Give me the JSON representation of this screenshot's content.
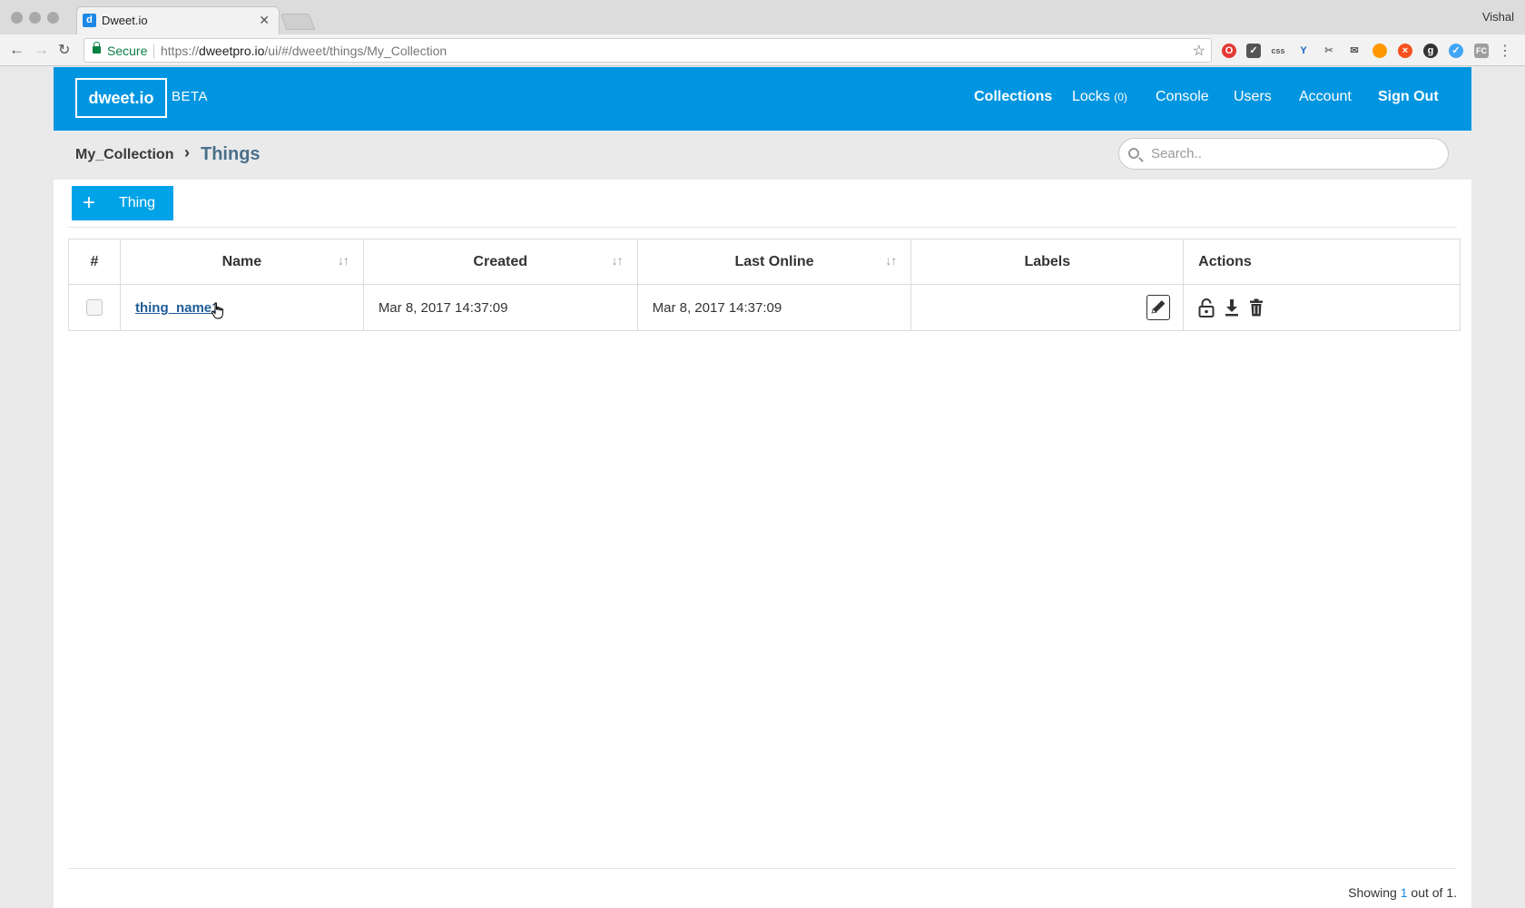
{
  "browser": {
    "tab_title": "Dweet.io",
    "tab_favicon_letter": "d",
    "profile_name": "Vishal",
    "security_label": "Secure",
    "url_scheme": "https://",
    "url_domain": "dweetpro.io",
    "url_path": "/ui/#/dweet/things/My_Collection",
    "extensions": [
      "opera-icon",
      "pocket-icon",
      "css-icon",
      "vue-icon",
      "scissors-icon",
      "mail-icon",
      "color-icon",
      "orange-icon",
      "ghostery-icon",
      "feather-icon",
      "fc-icon"
    ]
  },
  "header": {
    "logo": "dweet.io",
    "badge": "BETA",
    "nav": {
      "collections": "Collections",
      "locks": "Locks",
      "locks_count": "(0)",
      "console": "Console",
      "users": "Users",
      "account": "Account",
      "sign_out": "Sign Out"
    },
    "brand_color": "#0095e0"
  },
  "breadcrumb": {
    "parent": "My_Collection",
    "current": "Things"
  },
  "search": {
    "placeholder": "Search.."
  },
  "toolbar": {
    "add_icon": "+",
    "add_label": "Thing"
  },
  "table": {
    "columns": {
      "index": "#",
      "name": "Name",
      "created": "Created",
      "last_online": "Last Online",
      "labels": "Labels",
      "actions": "Actions"
    },
    "rows": [
      {
        "name": "thing_name1",
        "created": "Mar 8, 2017 14:37:09",
        "last_online": "Mar 8, 2017 14:37:09",
        "labels": "",
        "actions": [
          "unlock-icon",
          "download-icon",
          "trash-icon"
        ]
      }
    ]
  },
  "footer": {
    "prefix": "Showing",
    "shown": "1",
    "suffix": "out of 1."
  }
}
